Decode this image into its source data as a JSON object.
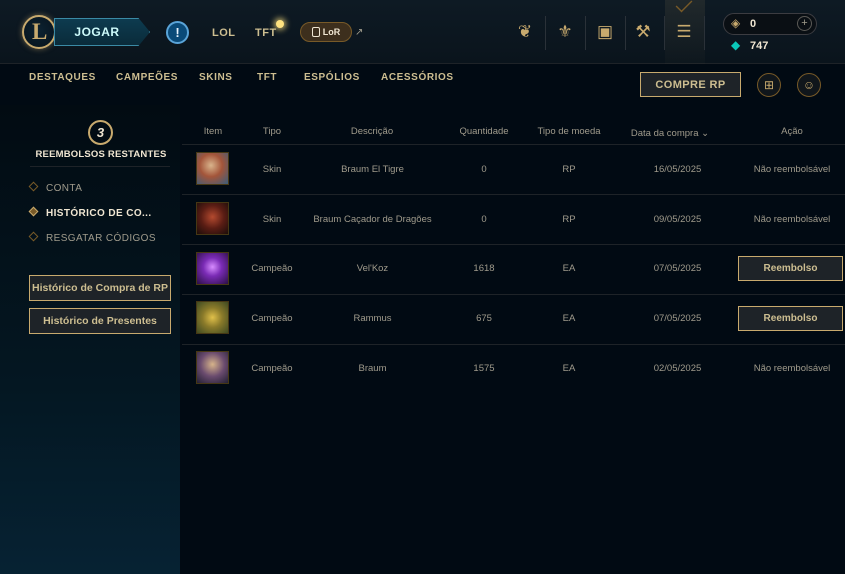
{
  "topbar": {
    "logo_letter": "L",
    "play_label": "JOGAR",
    "alert_glyph": "!",
    "nav_lol": "LOL",
    "nav_tft": "TFT",
    "lor_label": "LoR",
    "rp_amount": "0",
    "be_amount": "747",
    "icons": [
      "tft-emblem-icon",
      "clash-icon",
      "loot-chest-icon",
      "crafting-icon",
      "store-coins-icon"
    ]
  },
  "subnav": {
    "items": [
      "DESTAQUES",
      "CAMPEÕES",
      "SKINS",
      "TFT",
      "ESPÓLIOS",
      "ACESSÓRIOS"
    ],
    "buy_rp_label": "COMPRE RP"
  },
  "sidebar": {
    "refund_count": "3",
    "refund_label": "REEMBOLSOS RESTANTES",
    "items": [
      "CONTA",
      "HISTÓRICO DE CO...",
      "RESGATAR CÓDIGOS"
    ],
    "buttons": [
      "Histórico de Compra de RP",
      "Histórico de Presentes"
    ]
  },
  "table": {
    "headers": {
      "item": "Item",
      "tipo": "Tipo",
      "descricao": "Descrição",
      "quantidade": "Quantidade",
      "moeda": "Tipo de moeda",
      "data": "Data da compra",
      "acao": "Ação"
    },
    "rows": [
      {
        "tipo": "Skin",
        "descricao": "Braum El Tigre",
        "quantidade": "0",
        "moeda": "RP",
        "data": "16/05/2025",
        "acao": "Não reembolsável"
      },
      {
        "tipo": "Skin",
        "descricao": "Braum Caçador de Dragões",
        "quantidade": "0",
        "moeda": "RP",
        "data": "09/05/2025",
        "acao": "Não reembolsável"
      },
      {
        "tipo": "Campeão",
        "descricao": "Vel'Koz",
        "quantidade": "1618",
        "moeda": "EA",
        "data": "07/05/2025",
        "acao": "Reembolso"
      },
      {
        "tipo": "Campeão",
        "descricao": "Rammus",
        "quantidade": "675",
        "moeda": "EA",
        "data": "07/05/2025",
        "acao": "Reembolso"
      },
      {
        "tipo": "Campeão",
        "descricao": "Braum",
        "quantidade": "1575",
        "moeda": "EA",
        "data": "02/05/2025",
        "acao": "Não reembolsável"
      }
    ]
  },
  "colors": {
    "gold": "#c8aa6e",
    "gold_light": "#f0e6d2",
    "text_muted": "#a09b8c",
    "background": "#010a13",
    "blue_essence": "#0ac8b9"
  }
}
